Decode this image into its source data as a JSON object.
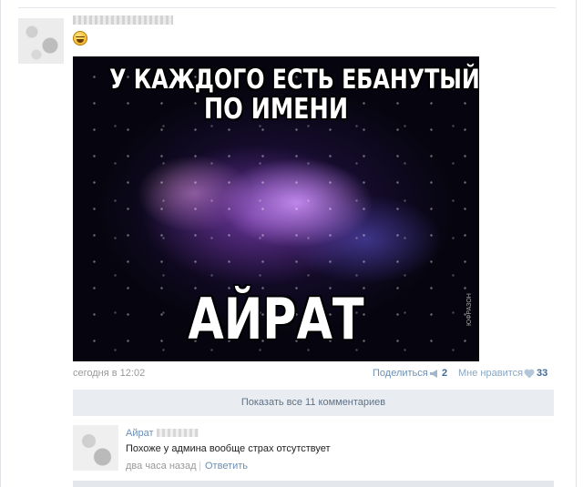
{
  "post": {
    "image": {
      "line1": "У КАЖДОГО ЕСТЬ ЕБАНУТЫЙ ДРУГ",
      "line2": "ПО ИМЕНИ",
      "line3": "АЙРАТ",
      "watermark": "ЮФРАЗОН"
    },
    "date": "сегодня в 12:02",
    "share": {
      "label": "Поделиться",
      "count": "2"
    },
    "like": {
      "label": "Мне нравится",
      "count": "33"
    }
  },
  "comments": {
    "show_all_label": "Показать все 11 комментариев",
    "items": [
      {
        "author": "Айрат",
        "text": "Похоже у админа вообще страх отсутствует",
        "time": "два часа назад",
        "separator": "|",
        "reply_label": "Ответить"
      }
    ]
  },
  "colors": {
    "link": "#6d8fb3",
    "count": "#3f6b9a",
    "meta": "#999999",
    "show_all_bg": "#e9edf1"
  }
}
